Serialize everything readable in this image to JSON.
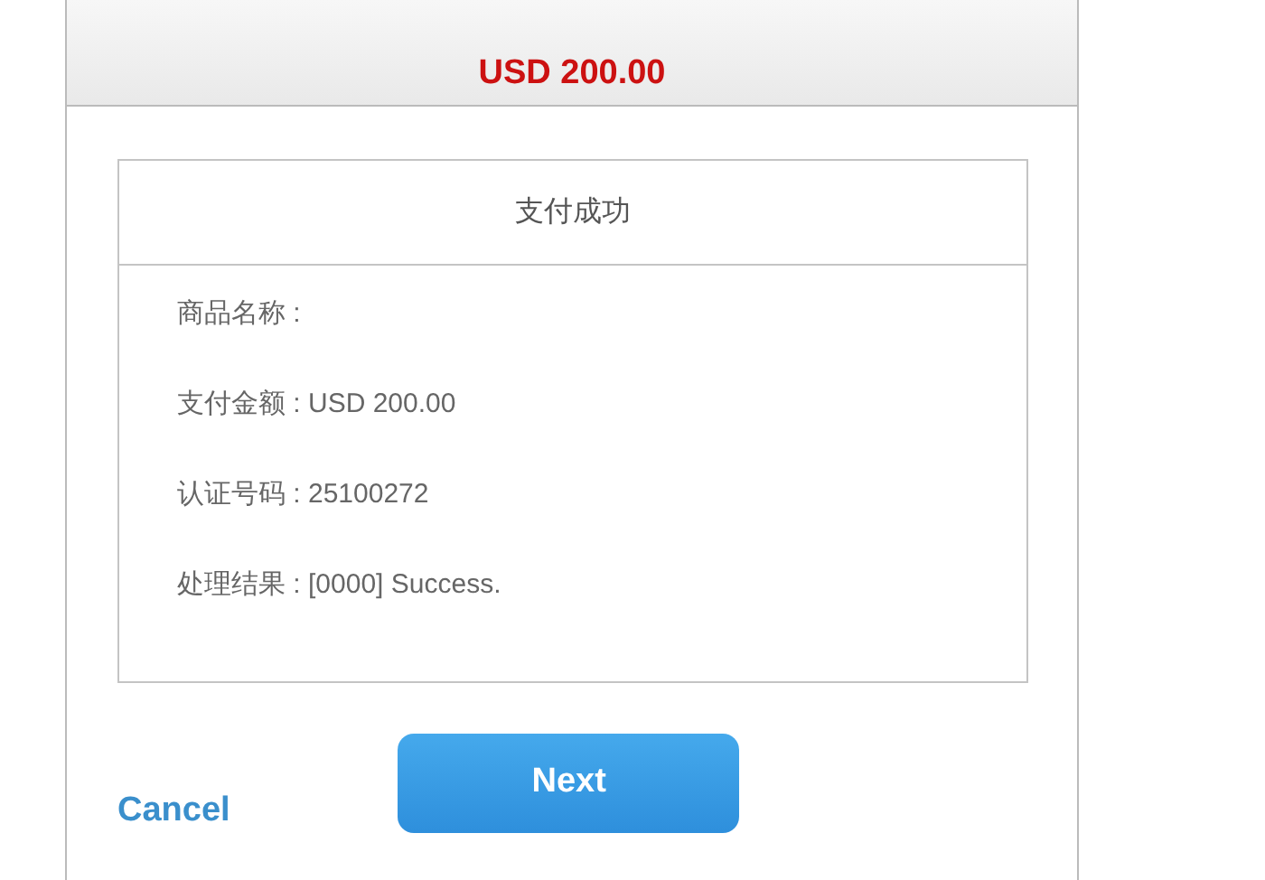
{
  "header": {
    "amount": "USD 200.00"
  },
  "result_panel": {
    "title": "支付成功",
    "lines": [
      "商品名称 :",
      "支付金额 : USD 200.00",
      "认证号码 : 25100272",
      "处理结果 : [0000] Success."
    ]
  },
  "actions": {
    "cancel": "Cancel",
    "next": "Next"
  }
}
